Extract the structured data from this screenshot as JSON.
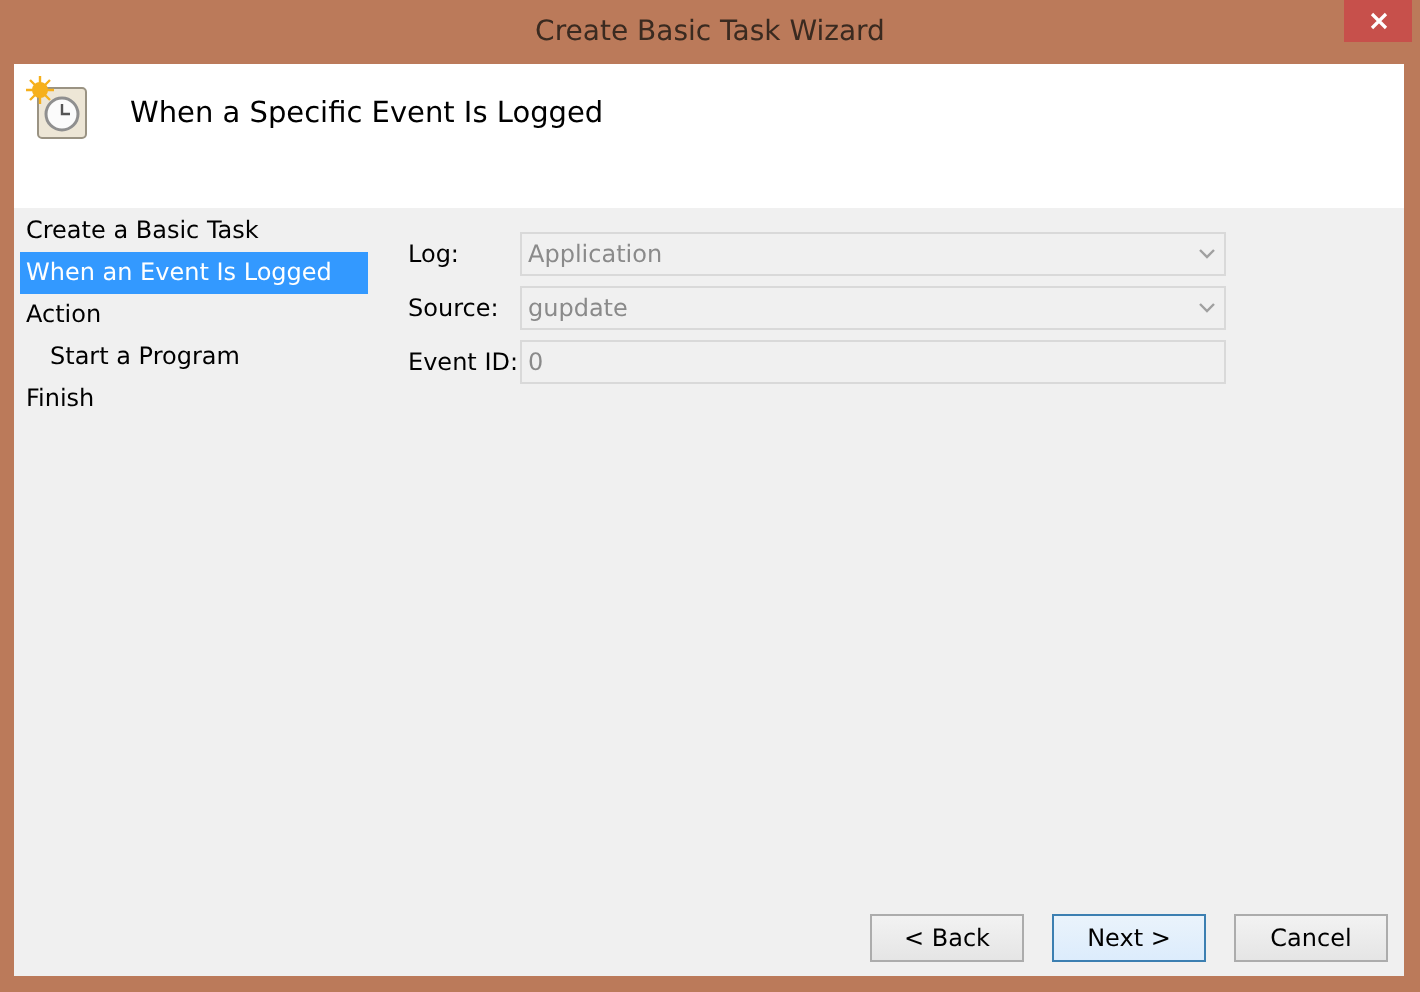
{
  "window": {
    "title": "Create Basic Task Wizard"
  },
  "header": {
    "title": "When a Specific Event Is Logged"
  },
  "steps": [
    {
      "label": "Create a Basic Task",
      "selected": false
    },
    {
      "label": "When an Event Is Logged",
      "selected": true
    },
    {
      "label": "Action",
      "selected": false,
      "children": [
        {
          "label": "Start a Program",
          "selected": false
        }
      ]
    },
    {
      "label": "Finish",
      "selected": false
    }
  ],
  "fields": [
    {
      "label": "Log:",
      "kind": "dropdown",
      "value": "Application",
      "disabled": true
    },
    {
      "label": "Source:",
      "kind": "combo",
      "value": "gupdate",
      "disabled": true
    },
    {
      "label": "Event ID:",
      "kind": "text",
      "value": "0",
      "disabled": true
    }
  ],
  "buttons": [
    {
      "label": "< Back",
      "default": false
    },
    {
      "label": "Next >",
      "default": true
    },
    {
      "label": "Cancel",
      "default": false
    }
  ]
}
